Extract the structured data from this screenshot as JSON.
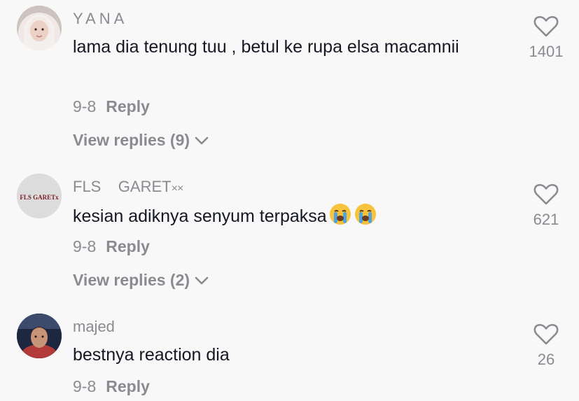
{
  "comments": [
    {
      "username": "YANA",
      "text": "lama dia tenung tuu , betul ke rupa elsa macamnii",
      "date": "9-8",
      "reply_label": "Reply",
      "view_replies": "View replies (9)",
      "likes": "1401"
    },
    {
      "username": "FLS    GARET",
      "username_suffix": "××",
      "avatar_text": "FLS GARETx",
      "text": "kesian adiknya senyum terpaksa",
      "date": "9-8",
      "reply_label": "Reply",
      "view_replies": "View replies (2)",
      "likes": "621"
    },
    {
      "username": "majed",
      "text": "bestnya reaction dia",
      "date": "9-8",
      "reply_label": "Reply",
      "likes": "26"
    }
  ]
}
